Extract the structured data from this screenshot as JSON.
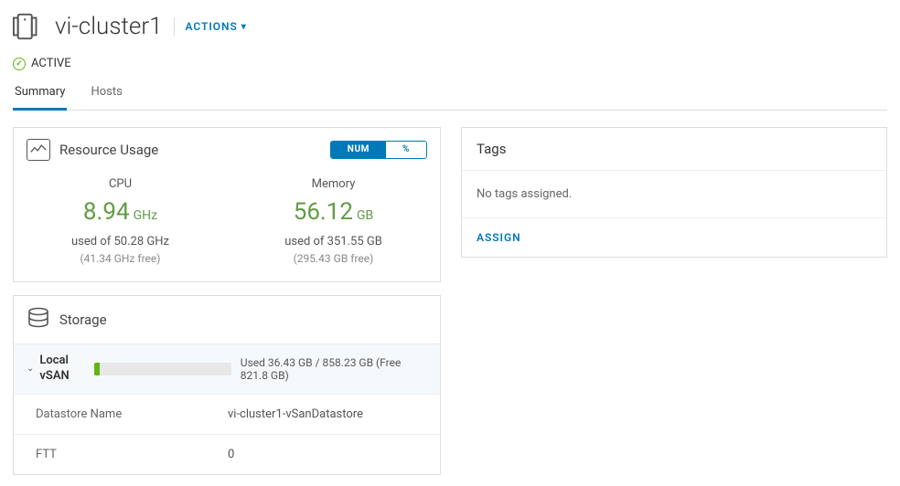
{
  "header": {
    "title": "vi-cluster1",
    "actions_label": "ACTIONS"
  },
  "status": {
    "label": "ACTIVE"
  },
  "tabs": {
    "summary": "Summary",
    "hosts": "Hosts"
  },
  "resource_usage": {
    "title": "Resource Usage",
    "toggle": {
      "num": "NUM",
      "pct": "%"
    },
    "cpu": {
      "label": "CPU",
      "value": "8.94",
      "unit": "GHz",
      "used_of": "used of 50.28 GHz",
      "free": "(41.34 GHz free)"
    },
    "memory": {
      "label": "Memory",
      "value": "56.12",
      "unit": "GB",
      "used_of": "used of 351.55 GB",
      "free": "(295.43 GB free)"
    }
  },
  "storage": {
    "title": "Storage",
    "local_label": "Local vSAN",
    "usage_text": "Used 36.43 GB / 858.23 GB (Free 821.8 GB)",
    "rows": {
      "datastore_name_key": "Datastore Name",
      "datastore_name_val": "vi-cluster1-vSanDatastore",
      "ftt_key": "FTT",
      "ftt_val": "0"
    }
  },
  "tags": {
    "title": "Tags",
    "empty": "No tags assigned.",
    "assign": "ASSIGN"
  }
}
